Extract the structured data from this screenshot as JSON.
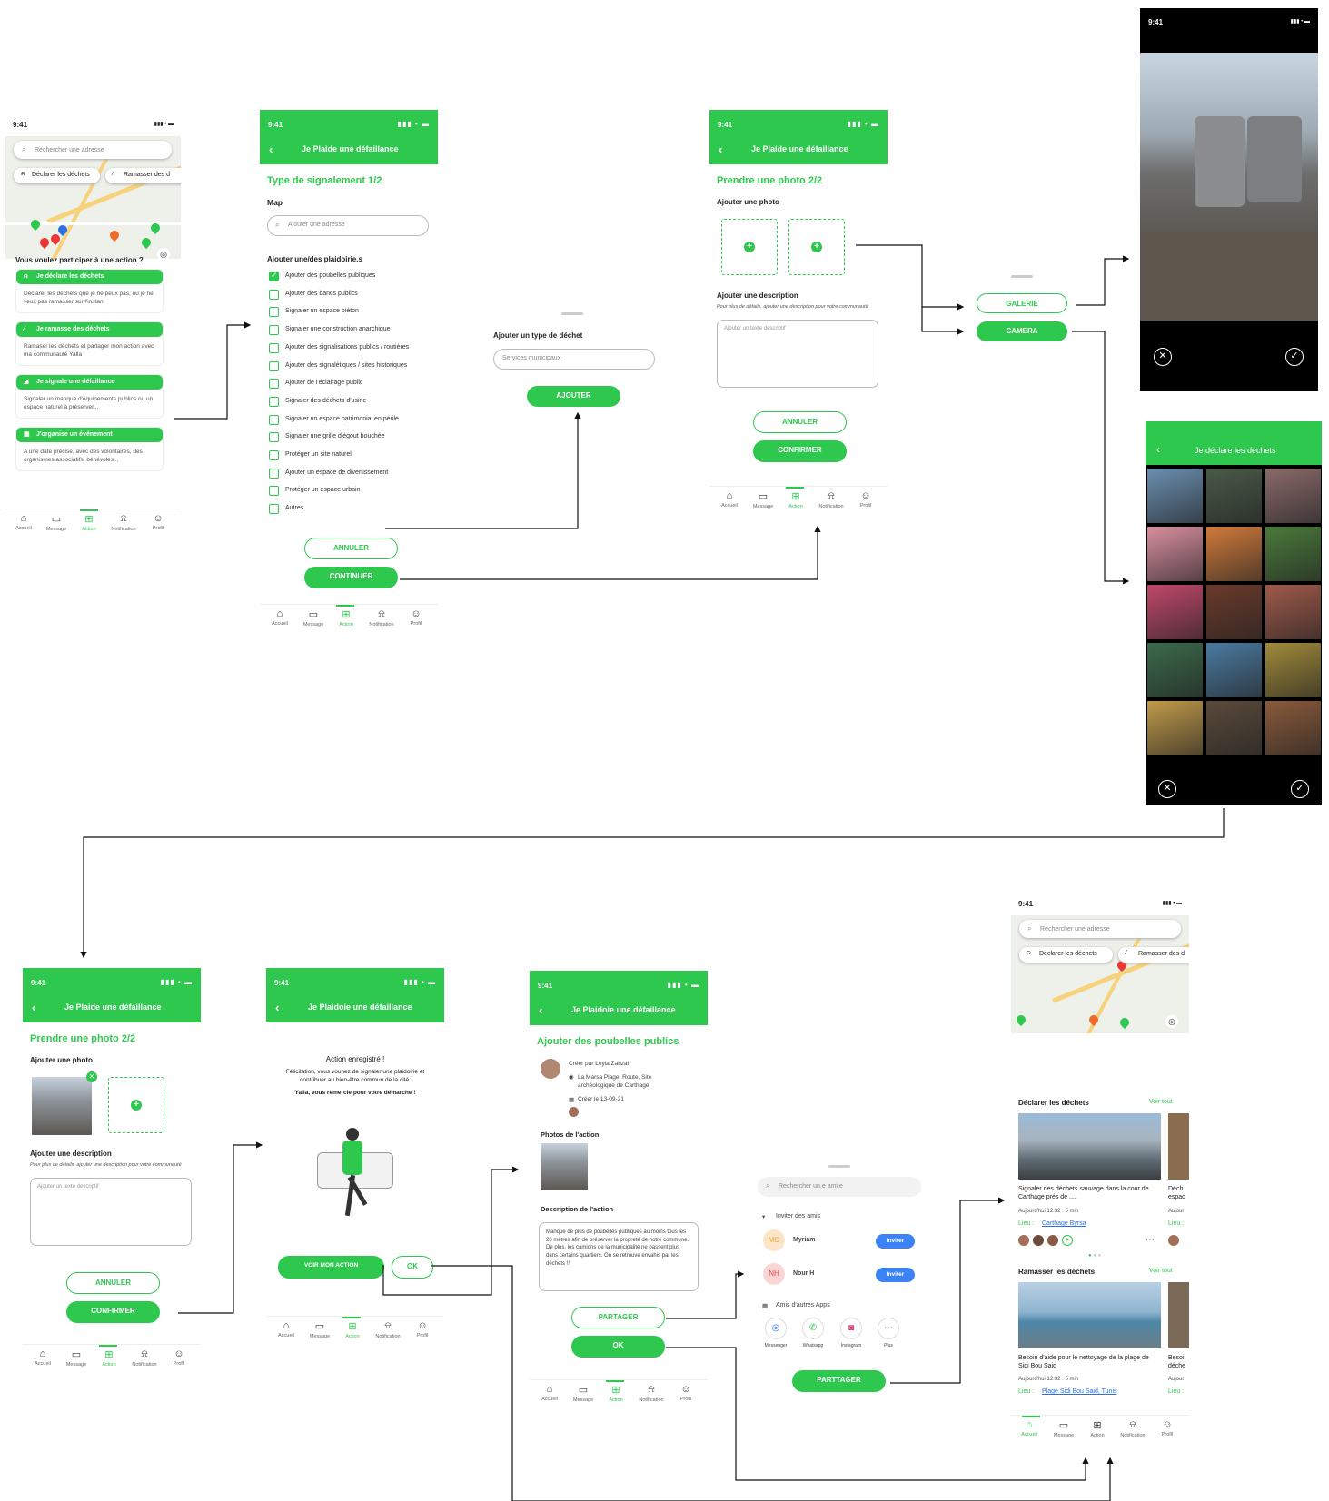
{
  "status": {
    "time": "9:41",
    "signal": "▮▮▮ • ▬"
  },
  "nav": {
    "home": "Accueil",
    "message": "Message",
    "action": "Action",
    "notification": "Notification",
    "profile": "Profil"
  },
  "screen1": {
    "search_placeholder": "Rechercher une adresse",
    "chip1": "Déclarer les déchets",
    "chip2": "Ramasser des d",
    "question": "Vous voulez participer à une action ?",
    "cards": [
      {
        "title": "Je déclare les déchets",
        "desc": "Déclarer les déchets que je ne peux pas, ou je ne veux pas ramasser sur l'instan"
      },
      {
        "title": "Je ramasse des déchets",
        "desc": "Ramaser les déchets et partager mon action avec ma communauté Yalla"
      },
      {
        "title": "Je signale une défaillance",
        "desc": "Signaler un manque d'équipements publics ou un espace naturel à préserver..."
      },
      {
        "title": "J'organise un événement",
        "desc": "A une date précise, avec des volontaires, des organismes associatifs, bénévoles..."
      }
    ]
  },
  "screen2": {
    "header": "Je Plaide une défaillance",
    "section": "Type de signalement 1/2",
    "map_label": "Map",
    "address_placeholder": "Ajouter une adresse",
    "list_label": "Ajouter une/des plaidoirie.s",
    "options": [
      "Ajouter des poubelles publiques",
      "Ajouter des bancs publics",
      "Signaler un espace piéton",
      "Signaler une construction anarchique",
      "Ajouter des signalisations publics / routières",
      "Ajouter des signalétiques / sites historiques",
      "Ajouter de l'éclairage public",
      "Signaler des déchets d'usine",
      "Signaler un espace patrimonial en périle",
      "Signaler une grille d'égout bouchée",
      "Protéger un site naturel",
      "Ajouter un espace de divertissement",
      "Protéger un espace urbain",
      "Autres"
    ],
    "cancel": "ANNULER",
    "continue": "CONTINUER"
  },
  "sheet_type": {
    "label": "Ajouter un type de déchet",
    "placeholder": "Services municipaux",
    "add": "AJOUTER"
  },
  "screen3": {
    "header": "Je Plaide une défaillance",
    "section": "Prendre une photo 2/2",
    "photo_label": "Ajouter une photo",
    "desc_label": "Ajouter une description",
    "desc_hint": "Pour plus de détails, ajouter une description pour votre communauté",
    "desc_placeholder": "Ajouter un texte descriptif",
    "cancel": "ANNULER",
    "confirm": "CONFIRMER"
  },
  "sheet_source": {
    "gallery": "GALERIE",
    "camera": "CAMERA"
  },
  "camera_screen": {
    "time": "9:41"
  },
  "gallery_screen": {
    "header": "Je déclare les déchets"
  },
  "screen4": {
    "header": "Je Plaide une défaillance",
    "section": "Prendre une photo 2/2",
    "photo_label": "Ajouter une photo",
    "desc_label": "Ajouter une description",
    "desc_hint": "Pour plus de détails, ajouter une description pour votre communauté",
    "desc_placeholder": "Ajouter un texte descriptif",
    "cancel": "ANNULER",
    "confirm": "CONFIRMER"
  },
  "screen5": {
    "header": "Je Plaidoie une défaillance",
    "title": "Action enregistré !",
    "msg": "Félicitation, vous vounez de signaler une plaidoirie et contribuer au bien-être commun de la cité.",
    "thanks": "Yalla, vous remercie pour votre démarche !",
    "view": "VOIR MON ACTION",
    "ok": "OK"
  },
  "screen6": {
    "header": "Je Plaidoie une défaillance",
    "section": "Ajouter des poubelles publics",
    "creator": "Créer par Leyla Zahzah",
    "location": "La Marsa Plage, Route, Site archéologique de Carthage",
    "created": "Créer le 13-09-21",
    "photos_label": "Photos de l'action",
    "desc_label": "Description de l'action",
    "desc": "Manque de plus de poubelles publiques au moins tous les 20 mètres afin de préserver la propreté de notre commune. De plus, les camions de la municipalité ne passent plus dans certains quartiers. On se retrouve envahis par les déchets !!",
    "share": "PARTAGER",
    "ok": "OK"
  },
  "share_sheet": {
    "search": "Rechercher un.e ami.e",
    "invite_label": "Inviter des amis",
    "friends": [
      {
        "initials": "MC",
        "name": "Myriam",
        "btn": "Inviter"
      },
      {
        "initials": "NH",
        "name": "Nour H",
        "btn": "Inviter"
      }
    ],
    "apps_label": "Amis d'autres Apps",
    "apps": [
      "Messenger",
      "Whatsapp",
      "Instagram",
      "Plus"
    ],
    "share": "PARTTAGER"
  },
  "screen8": {
    "search_placeholder": "Rechercher une adresse",
    "chip1": "Déclarer les déchets",
    "chip2": "Ramasser des d",
    "sec1": "Déclarer les déchets",
    "sec2": "Ramasser les déchets",
    "see_all": "Voir tout",
    "post1_title": "Signaler des déchets sauvage dans la cour de Carthage prés de ....",
    "post1_meta": "Aujourd'hui 12:32  .  5 min",
    "post1_place_label": "Lieu :",
    "post1_place": "Carthage Byrsa",
    "post1b_title": "Déch espac",
    "post1b_meta": "Aujour",
    "post1b_place": "Lieu :",
    "post2_title": "Besoin d'aide pour le nettoyage de la plage de Sidi Bou Said",
    "post2_meta": "Aujourd'hui 12:32  .  5 min",
    "post2_place_label": "Lieu :",
    "post2_place": "Plage Sidi Bou Said, Tunis",
    "post2b_title": "Besoi déche",
    "post2b_meta": "Aujour",
    "post2b_place": "Lieu :"
  },
  "colors": {
    "accent": "#2ec84f",
    "invite": "#3b82f6"
  }
}
